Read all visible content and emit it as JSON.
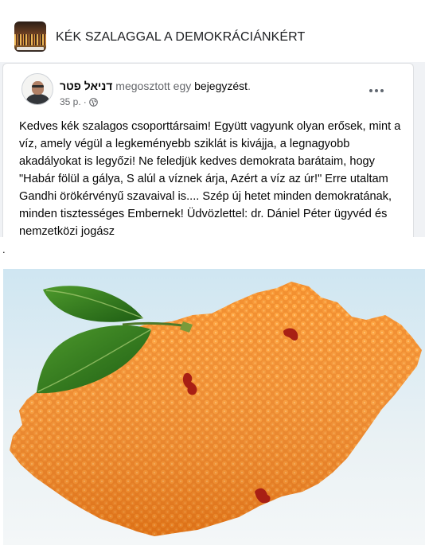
{
  "group": {
    "title": "KÉK SZALAGGAL A DEMOKRÁCIÁNKÉRT",
    "avatar_icon": "group-photo-icon"
  },
  "post": {
    "author_name": "דניאל פטר",
    "action_text": " megosztott egy ",
    "shared_link": "bejegyzést",
    "action_end": ".",
    "timestamp": "35 p.",
    "meta_separator": "·",
    "audience_icon": "globe-icon",
    "more_icon": "more-options-icon",
    "body": "Kedves kék szalagos csoporttársaim! Együtt vagyunk olyan erősek, mint a víz, amely végül a legkeményebb sziklát is kivájja, a legnagyobb akadályokat is legyőzi! Ne feledjük kedves demokrata barátaim, hogy \"Habár fölül a gálya, S alúl a víznek árja, Azért a víz az úr!\" Erre utaltam Gandhi örökérvényű szavaival is.... Szép új hetet minden demokratának, minden tisztességes Embernek! Üdvözlettel: dr. Dániel Péter ügyvéd és nemzetközi jogász"
  },
  "separator": ".",
  "image": {
    "icon": "orange-hungary-map-image",
    "colors": {
      "sky_top": "#cfe6f2",
      "sky_bottom": "#f4f7f8",
      "orange": "#f2851c",
      "orange_light": "#ffa53a",
      "leaf": "#2f7d1f",
      "spot": "#a81f14"
    }
  }
}
